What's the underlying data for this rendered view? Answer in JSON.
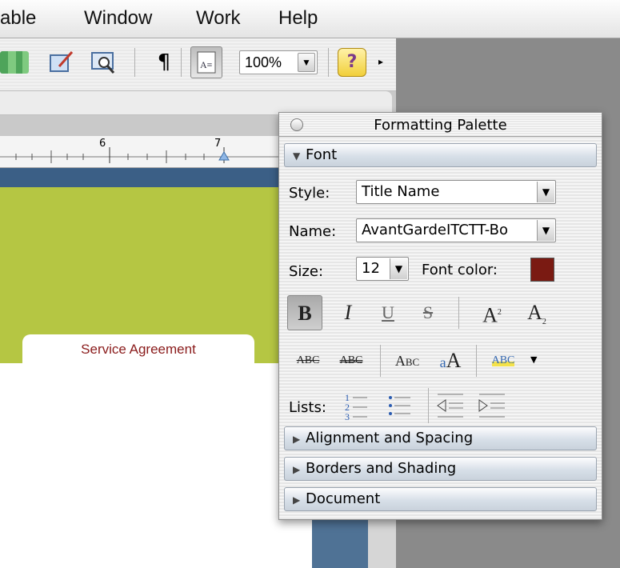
{
  "menu": {
    "items": [
      "able",
      "Window",
      "Work",
      "Help"
    ]
  },
  "toolbar": {
    "zoom_value": "100%",
    "pilcrow": "¶"
  },
  "document": {
    "tab_label": "Service Agreement",
    "ruler_mark_6": "6",
    "ruler_mark_7": "7"
  },
  "palette": {
    "title": "Formatting Palette",
    "font_section": "Font",
    "style_label": "Style:",
    "style_value": "Title Name",
    "name_label": "Name:",
    "name_value": "AvantGardeITCTT-Bo",
    "size_label": "Size:",
    "size_value": "12",
    "font_color_label": "Font color:",
    "font_color": "#7a1a12",
    "lists_label": "Lists:",
    "sections": [
      "Alignment and Spacing",
      "Borders and Shading",
      "Document"
    ]
  }
}
